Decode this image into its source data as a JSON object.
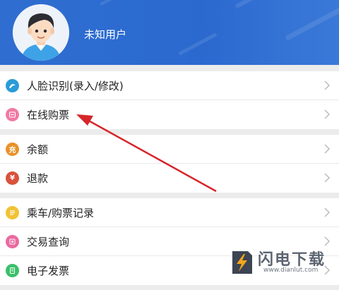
{
  "user": {
    "name": "未知用户"
  },
  "groups": [
    {
      "items": [
        {
          "label": "人脸识别(录入/修改)",
          "icon": "face-recognition-icon",
          "color": "#2a9bd8",
          "glyph": ""
        },
        {
          "label": "在线购票",
          "icon": "ticket-icon",
          "color": "#f07aa4",
          "glyph": ""
        }
      ]
    },
    {
      "items": [
        {
          "label": "余额",
          "icon": "balance-icon",
          "color": "#e8922a",
          "glyph": "充"
        },
        {
          "label": "退款",
          "icon": "refund-icon",
          "color": "#d9533c",
          "glyph": "¥"
        }
      ]
    },
    {
      "items": [
        {
          "label": "乘车/购票记录",
          "icon": "ride-record-icon",
          "color": "#f2c233",
          "glyph": ""
        },
        {
          "label": "交易查询",
          "icon": "transaction-icon",
          "color": "#ea6aa0",
          "glyph": ""
        },
        {
          "label": "电子发票",
          "icon": "invoice-icon",
          "color": "#3bbf6a",
          "glyph": ""
        }
      ]
    }
  ],
  "watermark": {
    "title": "闪电下载",
    "url": "www.dianlut.com"
  },
  "annotation_color": "#d6262a"
}
